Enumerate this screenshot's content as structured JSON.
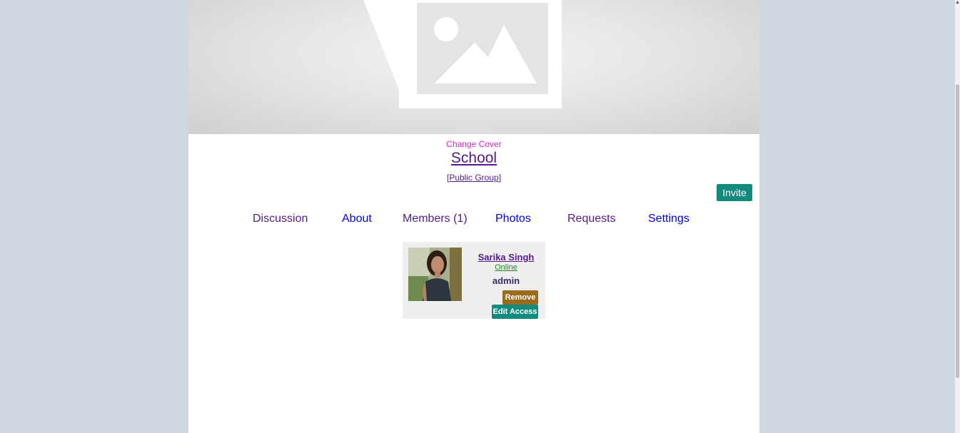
{
  "cover": {
    "change_cover_label": "Change Cover",
    "icon": "image-placeholder-icon"
  },
  "group": {
    "title": "School",
    "type_prefix": "[",
    "type_label": "Public Group",
    "type_suffix": "]"
  },
  "actions": {
    "invite_label": "Invite"
  },
  "tabs": [
    {
      "label": "Discussion"
    },
    {
      "label": "About"
    },
    {
      "label": "Members (1)"
    },
    {
      "label": "Photos"
    },
    {
      "label": "Requests"
    },
    {
      "label": "Settings"
    }
  ],
  "members": [
    {
      "name": "Sarika Singh",
      "status": "Online",
      "role": "admin",
      "remove_label": "Remove",
      "edit_access_label": "Edit Access"
    }
  ],
  "colors": {
    "page_background": "#d0d7e2",
    "invite": "#138a7e",
    "remove": "#9a6b1b",
    "change_cover": "#e020c8",
    "visited_link": "#551a8b",
    "link": "#0000ee"
  }
}
